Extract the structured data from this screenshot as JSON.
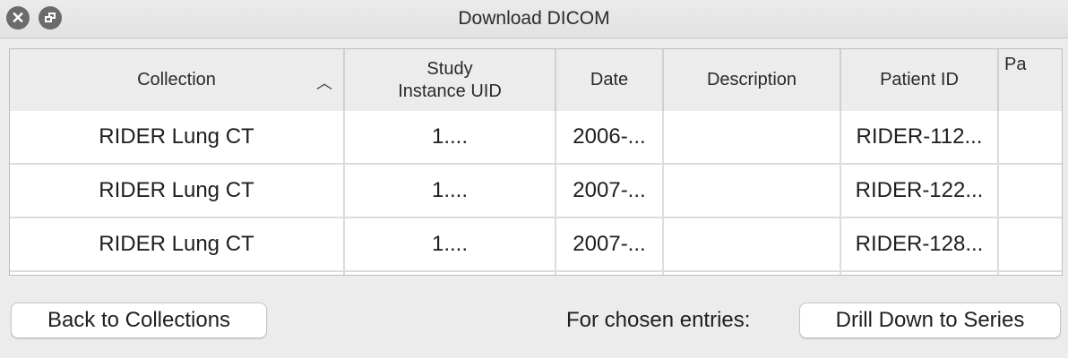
{
  "window": {
    "title": "Download DICOM",
    "close_icon": "close-icon",
    "restore_icon": "restore-icon"
  },
  "table": {
    "columns": [
      {
        "label": "Collection",
        "sorted": "ascending"
      },
      {
        "label_line1": "Study",
        "label_line2": "Instance UID"
      },
      {
        "label": "Date"
      },
      {
        "label": "Description"
      },
      {
        "label": "Patient ID"
      },
      {
        "label": "Pa"
      }
    ],
    "rows": [
      {
        "collection": "RIDER Lung CT",
        "study_uid": "1....",
        "date": "2006-...",
        "description": "",
        "patient_id": "RIDER-112..."
      },
      {
        "collection": "RIDER Lung CT",
        "study_uid": "1....",
        "date": "2007-...",
        "description": "",
        "patient_id": "RIDER-122..."
      },
      {
        "collection": "RIDER Lung CT",
        "study_uid": "1....",
        "date": "2007-...",
        "description": "",
        "patient_id": "RIDER-128..."
      }
    ]
  },
  "footer": {
    "back_label": "Back to Collections",
    "chosen_label": "For chosen entries:",
    "drill_label": "Drill Down to Series"
  }
}
